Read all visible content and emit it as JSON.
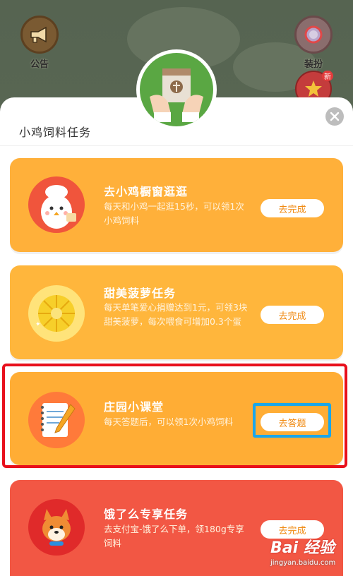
{
  "background": {
    "announce_label": "公告",
    "dress_label": "装扮",
    "badge_new": "新"
  },
  "sheet": {
    "title": "小鸡饲料任务"
  },
  "tasks": [
    {
      "title": "去小鸡橱窗逛逛",
      "desc": "每天和小鸡一起逛15秒，可以领1次小鸡饲料",
      "button": "去完成",
      "color": "#ffb03a",
      "icon": "chicken-chef-icon"
    },
    {
      "title": "甜美菠萝任务",
      "desc": "每天单笔爱心捐赠达到1元，可领3块甜美菠萝，每次喂食可增加0.3个蛋",
      "button": "去完成",
      "color": "#ffb63c",
      "icon": "pineapple-icon"
    },
    {
      "title": "庄园小课堂",
      "desc": "每天答题后，可以领1次小鸡饲料",
      "button": "去答题",
      "color": "#ffad35",
      "icon": "notebook-pencil-icon"
    },
    {
      "title": "饿了么专享任务",
      "desc": "去支付宝-饿了么下单，领180g专享饲料",
      "button": "去完成",
      "color": "#f25744",
      "icon": "shiba-dog-icon"
    }
  ],
  "watermark": {
    "main": "Bai 经验",
    "sub": "jingyan.baidu.com"
  },
  "colors": {
    "accent": "#f08a12",
    "highlight_red": "#e8101c",
    "highlight_blue": "#1aa6ea"
  }
}
